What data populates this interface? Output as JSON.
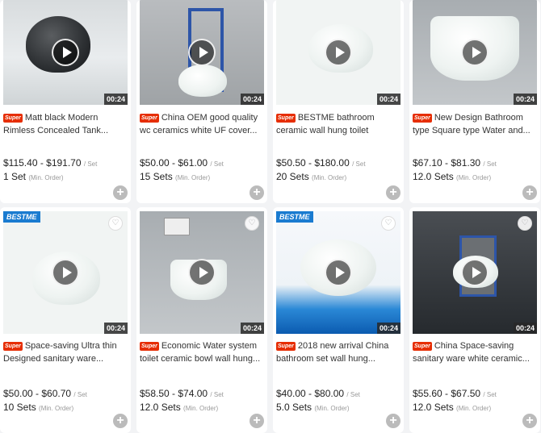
{
  "common": {
    "duration": "00:24",
    "unit": "/ Set",
    "min_order": "(Min. Order)",
    "super_tag": "Super",
    "brand": "BESTME"
  },
  "products": [
    {
      "title": "Matt black Modern Rimless Concealed Tank...",
      "price": "$115.40 - $191.70",
      "moq": "1 Set"
    },
    {
      "title": "China OEM good quality wc ceramics white UF cover...",
      "price": "$50.00 - $61.00",
      "moq": "15 Sets"
    },
    {
      "title": "BESTME bathroom ceramic wall hung toilet",
      "price": "$50.50 - $180.00",
      "moq": "20 Sets"
    },
    {
      "title": "New Design Bathroom type Square type Water and...",
      "price": "$67.10 - $81.30",
      "moq": "12.0 Sets"
    },
    {
      "title": "Space-saving Ultra thin Designed sanitary ware...",
      "price": "$50.00 - $60.70",
      "moq": "10 Sets"
    },
    {
      "title": "Economic Water system toilet ceramic bowl wall hung...",
      "price": "$58.50 - $74.00",
      "moq": "12.0 Sets"
    },
    {
      "title": "2018 new arrival China bathroom set wall hung...",
      "price": "$40.00 - $80.00",
      "moq": "5.0 Sets"
    },
    {
      "title": "China Space-saving sanitary ware white ceramic...",
      "price": "$55.60 - $67.50",
      "moq": "12.0 Sets"
    }
  ]
}
